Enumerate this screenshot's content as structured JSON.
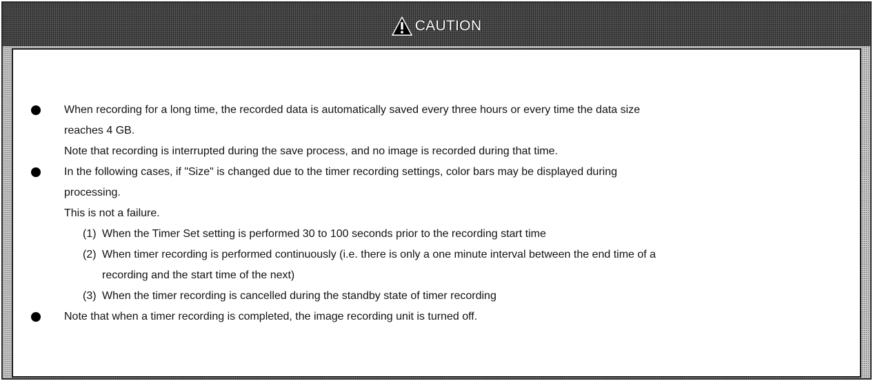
{
  "caution": {
    "title": "CAUTION",
    "header_icon": "warning-triangle-icon",
    "colors": {
      "header_bg": "#555555",
      "frame_bg": "#c8c8c8",
      "panel_bg": "#ffffff",
      "text": "#111111"
    },
    "bullets": [
      {
        "lines": [
          "When recording for a long time, the recorded data is automatically saved every three hours or every time the data size",
          "reaches 4 GB."
        ],
        "note": "Note that recording is interrupted during the save process, and no image is recorded during that time."
      },
      {
        "lines": [
          "In the following cases, if \"Size\" is changed due to the timer recording settings, color bars may be displayed during",
          "processing."
        ],
        "note": "This is not a failure.",
        "items": [
          {
            "number": "(1)",
            "lines": [
              "When the Timer Set setting is performed 30 to 100 seconds prior to the recording start time"
            ]
          },
          {
            "number": "(2)",
            "lines": [
              "When timer recording is performed continuously (i.e. there is only a one minute interval between the end time of a",
              "recording and the start time of the next)"
            ]
          },
          {
            "number": "(3)",
            "lines": [
              "When the timer recording is cancelled during the standby state of timer recording"
            ]
          }
        ]
      },
      {
        "lines": [
          "Note that when a timer recording is completed, the image recording unit is turned off."
        ]
      }
    ]
  }
}
